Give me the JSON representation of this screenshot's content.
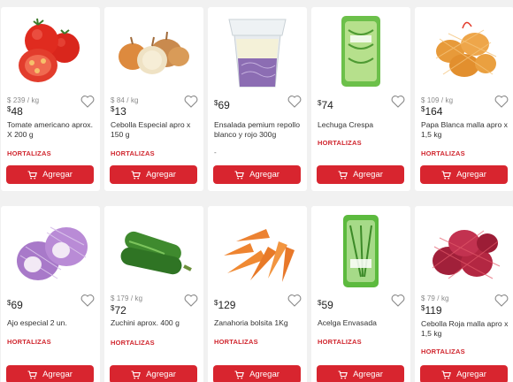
{
  "products": [
    {
      "unit": "$ 239 / kg",
      "price": "48",
      "name": "Tomate americano aprox. X 200 g",
      "category": "HORTALIZAS",
      "button": "Agregar",
      "image": "tomatoes"
    },
    {
      "unit": "$ 84 / kg",
      "price": "13",
      "name": "Cebolla Especial apro x 150 g",
      "category": "HORTALIZAS",
      "button": "Agregar",
      "image": "onions"
    },
    {
      "unit": "",
      "price": "69",
      "name": "Ensalada pemium repollo blanco y rojo 300g",
      "category": "",
      "extra": "-",
      "button": "Agregar",
      "image": "salad-cup"
    },
    {
      "unit": "",
      "price": "74",
      "name": "Lechuga Crespa",
      "category": "HORTALIZAS",
      "button": "Agregar",
      "image": "lettuce-bag"
    },
    {
      "unit": "$ 109 / kg",
      "price": "164",
      "name": "Papa Blanca malla apro x 1,5 kg",
      "category": "HORTALIZAS",
      "button": "Agregar",
      "image": "potatoes-mesh"
    },
    {
      "unit": "",
      "price": "69",
      "name": "Ajo especial 2 un.",
      "category": "HORTALIZAS",
      "button": "Agregar",
      "image": "garlic"
    },
    {
      "unit": "$ 179 / kg",
      "price": "72",
      "name": "Zuchini aprox. 400 g",
      "category": "HORTALIZAS",
      "button": "Agregar",
      "image": "zucchini"
    },
    {
      "unit": "",
      "price": "129",
      "name": "Zanahoria bolsita 1Kg",
      "category": "HORTALIZAS",
      "button": "Agregar",
      "image": "carrots"
    },
    {
      "unit": "",
      "price": "59",
      "name": "Acelga Envasada",
      "category": "HORTALIZAS",
      "button": "Agregar",
      "image": "chard-bag"
    },
    {
      "unit": "$ 79 / kg",
      "price": "119",
      "name": "Cebolla Roja malla apro x 1,5 kg",
      "category": "HORTALIZAS",
      "button": "Agregar",
      "image": "red-onions-mesh"
    }
  ],
  "currency_symbol": "$",
  "colors": {
    "accent": "#d8252f",
    "category": "#d0262e",
    "background": "#f1f1f1"
  },
  "icons": {
    "favorite": "heart-outline-icon",
    "cart": "cart-icon"
  }
}
